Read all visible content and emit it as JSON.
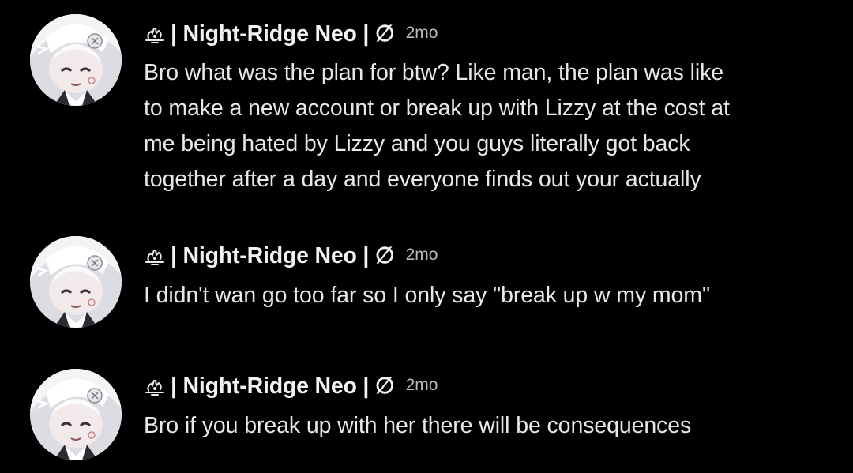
{
  "messages": [
    {
      "author": "| Night-Ridge Neo | ∅",
      "role_icon": "hand-emblem-icon",
      "timestamp": "2mo",
      "lines": [
        "Bro what was the plan for btw? Like man, the plan was like",
        "to make a new account or break up with Lizzy at the cost at",
        "me being hated by Lizzy and you guys literally got back",
        "together after a day and everyone finds out your actually"
      ]
    },
    {
      "author": "| Night-Ridge Neo | ∅",
      "role_icon": "hand-emblem-icon",
      "timestamp": "2mo",
      "lines": [
        "I didn't wan go too far so I only say \"break up w my mom\""
      ]
    },
    {
      "author": "| Night-Ridge Neo | ∅",
      "role_icon": "hand-emblem-icon",
      "timestamp": "2mo",
      "lines": [
        "Bro if you break up with her there will be consequences"
      ]
    }
  ],
  "colors": {
    "background": "#000000",
    "username": "#f2f2f2",
    "message_text": "#e8e8e8",
    "timestamp": "#bdbdbd"
  }
}
